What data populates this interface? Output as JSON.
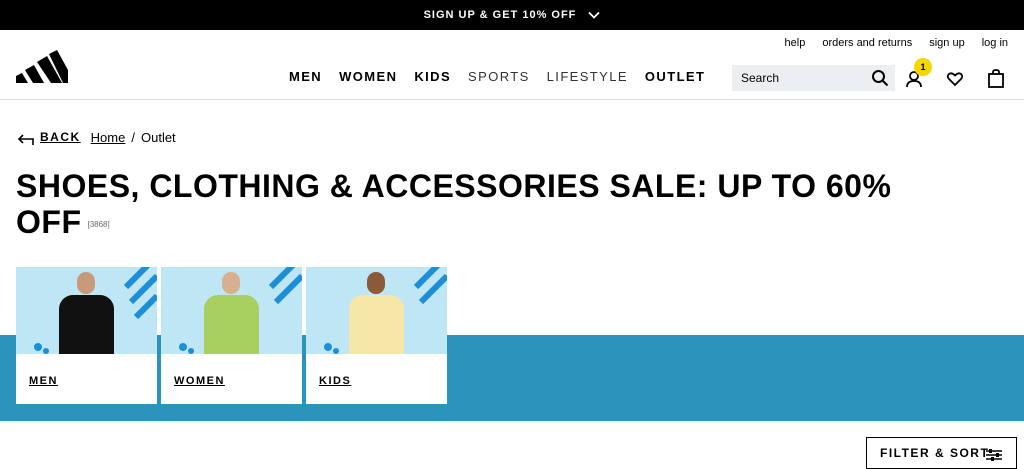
{
  "promo": {
    "text": "SIGN UP & GET 10% OFF"
  },
  "utility": {
    "help": "help",
    "orders": "orders and returns",
    "signup": "sign up",
    "login": "log in"
  },
  "nav": [
    "MEN",
    "WOMEN",
    "KIDS",
    "SPORTS",
    "LIFESTYLE",
    "OUTLET"
  ],
  "search": {
    "placeholder": "Search"
  },
  "account": {
    "badge": "1"
  },
  "breadcrumb": {
    "back": "BACK",
    "home": "Home",
    "sep": "/",
    "current": "Outlet"
  },
  "page": {
    "title": "SHOES, CLOTHING & ACCESSORIES SALE: UP TO 60% OFF",
    "count": "[3868]"
  },
  "categories": [
    {
      "label": "MEN"
    },
    {
      "label": "WOMEN"
    },
    {
      "label": "KIDS"
    }
  ],
  "filter": {
    "label": "FILTER & SORT"
  },
  "colors": {
    "promo_bg": "#000000",
    "band": "#2b93bc",
    "badge": "#f6d600",
    "card_img": "#bfe6f4"
  },
  "icons": [
    "chevron-down-icon",
    "adidas-logo",
    "search-icon",
    "account-icon",
    "heart-icon",
    "bag-icon",
    "back-arrow-icon",
    "filter-icon"
  ]
}
